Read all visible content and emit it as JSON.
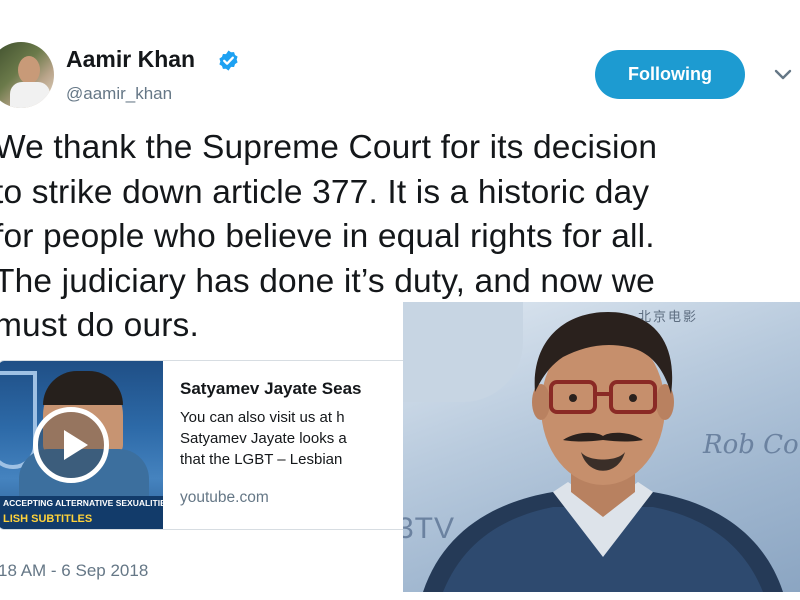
{
  "user": {
    "name": "Aamir Khan",
    "handle": "@aamir_khan"
  },
  "follow_button": {
    "label": "Following"
  },
  "tweet": {
    "text": "We thank the Supreme Court for its decision\nto strike down article 377. It is a historic day\nfor people who believe in equal rights for all.\nThe judiciary has done it’s duty, and now we\nmust do ours."
  },
  "card": {
    "title": "Satyamev Jayate Seas",
    "description": "You can also visit us at h\nSatyamev Jayate looks a\nthat the LGBT – Lesbian",
    "domain": "youtube.com",
    "thumb_caption_line1": "ACCEPTING ALTERNATIVE SEXUALITIES",
    "thumb_caption_line2": "LISH SUBTITLES"
  },
  "timestamp": "18 AM - 6 Sep 2018",
  "photo": {
    "banner_text": "北京电影",
    "logo_text": "3TV",
    "sign_text": "Rob Co"
  },
  "colors": {
    "accent": "#1d9bd1",
    "verified": "#1da1f2",
    "secondary_text": "#657786"
  },
  "icons": {
    "verified": "verified-badge-icon",
    "chevron": "chevron-down-icon",
    "play": "play-icon"
  }
}
